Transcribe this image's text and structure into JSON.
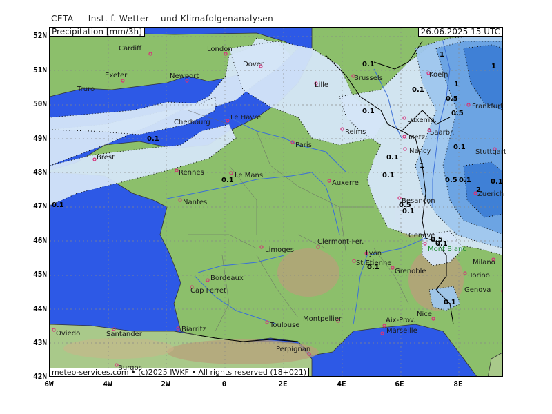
{
  "header": {
    "title": "CETA — Inst. f. Wetter— und Klimafolgenanalysen —",
    "parameter": "Precipitation [mm/3h]",
    "valid_time": "26.06.2025 15 UTC",
    "footer": "meteo-services.com • (c)2025 IWKF • All rights reserved (18+021)"
  },
  "axes": {
    "lat_labels": [
      "52N",
      "51N",
      "50N",
      "49N",
      "48N",
      "47N",
      "46N",
      "45N",
      "44N",
      "43N",
      "42N"
    ],
    "lon_labels": [
      "6W",
      "4W",
      "2W",
      "0",
      "2E",
      "4E",
      "6E",
      "8E"
    ]
  },
  "cities": [
    {
      "name": "Cardiff",
      "kind": "city"
    },
    {
      "name": "London",
      "kind": "city"
    },
    {
      "name": "Dover",
      "kind": "city"
    },
    {
      "name": "Exeter",
      "kind": "city"
    },
    {
      "name": "Newport",
      "kind": "city"
    },
    {
      "name": "Truro",
      "kind": "city"
    },
    {
      "name": "Lille",
      "kind": "city"
    },
    {
      "name": "Brussels",
      "kind": "city"
    },
    {
      "name": "Koeln",
      "kind": "city"
    },
    {
      "name": "Frankfurt",
      "kind": "city"
    },
    {
      "name": "Luxemb.",
      "kind": "city"
    },
    {
      "name": "Saarbr.",
      "kind": "city"
    },
    {
      "name": "Metz",
      "kind": "city"
    },
    {
      "name": "Nancy",
      "kind": "city"
    },
    {
      "name": "Stuttgart",
      "kind": "city"
    },
    {
      "name": "Le Havre",
      "kind": "city"
    },
    {
      "name": "Cherbourg",
      "kind": "city"
    },
    {
      "name": "Reims",
      "kind": "city"
    },
    {
      "name": "Paris",
      "kind": "city"
    },
    {
      "name": "Brest",
      "kind": "city"
    },
    {
      "name": "Rennes",
      "kind": "city"
    },
    {
      "name": "Le Mans",
      "kind": "city"
    },
    {
      "name": "Auxerre",
      "kind": "city"
    },
    {
      "name": "Besançon",
      "kind": "city"
    },
    {
      "name": "Zuerich",
      "kind": "city"
    },
    {
      "name": "Nantes",
      "kind": "city"
    },
    {
      "name": "Geneve",
      "kind": "city"
    },
    {
      "name": "Mont Blanc",
      "kind": "mountain"
    },
    {
      "name": "Clermont-Fer.",
      "kind": "city"
    },
    {
      "name": "Limoges",
      "kind": "city"
    },
    {
      "name": "Lyon",
      "kind": "city"
    },
    {
      "name": "St.Etienne",
      "kind": "city"
    },
    {
      "name": "Grenoble",
      "kind": "city"
    },
    {
      "name": "Milano",
      "kind": "city"
    },
    {
      "name": "Torino",
      "kind": "city"
    },
    {
      "name": "Bordeaux",
      "kind": "city"
    },
    {
      "name": "Cap Ferret",
      "kind": "city"
    },
    {
      "name": "Genova",
      "kind": "city"
    },
    {
      "name": "Nice",
      "kind": "city"
    },
    {
      "name": "Toulouse",
      "kind": "city"
    },
    {
      "name": "Montpellier",
      "kind": "city"
    },
    {
      "name": "Aix-Prov.",
      "kind": "city"
    },
    {
      "name": "Marseille",
      "kind": "city"
    },
    {
      "name": "Biarritz",
      "kind": "city"
    },
    {
      "name": "Oviedo",
      "kind": "city"
    },
    {
      "name": "Santander",
      "kind": "city"
    },
    {
      "name": "Perpignan",
      "kind": "city"
    },
    {
      "name": "Burgos",
      "kind": "city"
    }
  ],
  "contour_values": [
    "0.1",
    "0.1",
    "0.1",
    "0.1",
    "0.1",
    "0.1",
    "0.1",
    "0.1",
    "0.1",
    "0.1",
    "0.1",
    "0.1",
    "0.1",
    "0.1",
    "0.1",
    "0.5",
    "0.5",
    "0.5",
    "0.5",
    "0.5",
    "1",
    "1",
    "1",
    "1",
    "2"
  ],
  "colors": {
    "sea": "#2d59e6",
    "land_low": "#8cbf6b",
    "land_mid": "#a9c98a",
    "mountain": "#b8a07a",
    "precip_01": "#d5e6f8",
    "precip_05": "#9fc7ee",
    "precip_1": "#6aa3e3",
    "precip_2": "#3d7fd6",
    "grid": "#888888"
  }
}
